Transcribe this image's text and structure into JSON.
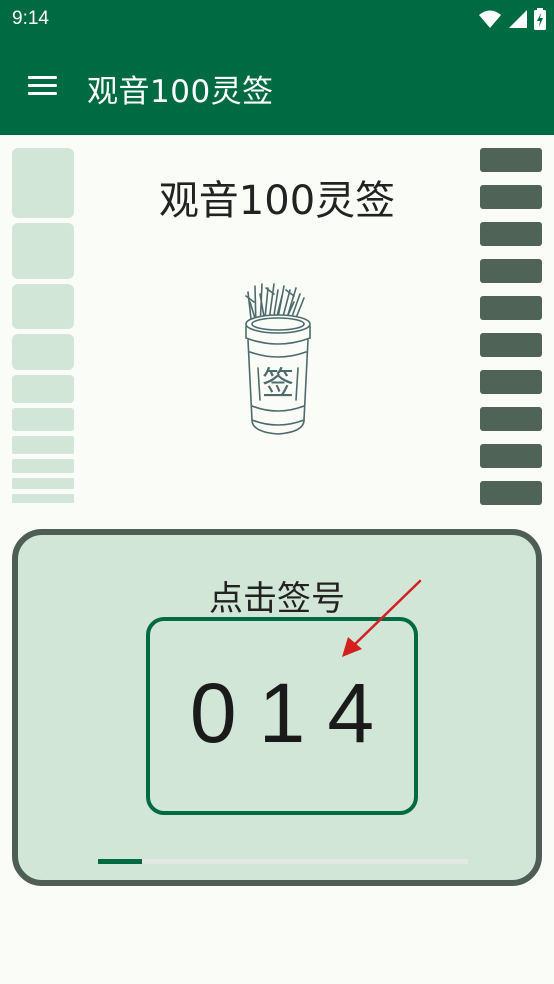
{
  "status_bar": {
    "time": "9:14"
  },
  "app_bar": {
    "title": "观音100灵签",
    "menu_icon": "hamburger-menu-icon"
  },
  "main": {
    "title": "观音100灵签",
    "tube_label": "签",
    "draw_panel": {
      "label": "点击签号",
      "number": "014",
      "progress": 0.12
    }
  },
  "colors": {
    "primary": "#006b43",
    "panel_bg": "#d2e6d8",
    "panel_border": "#4e5d55",
    "right_blocks": "#4f6457",
    "arrow": "#d32020"
  }
}
